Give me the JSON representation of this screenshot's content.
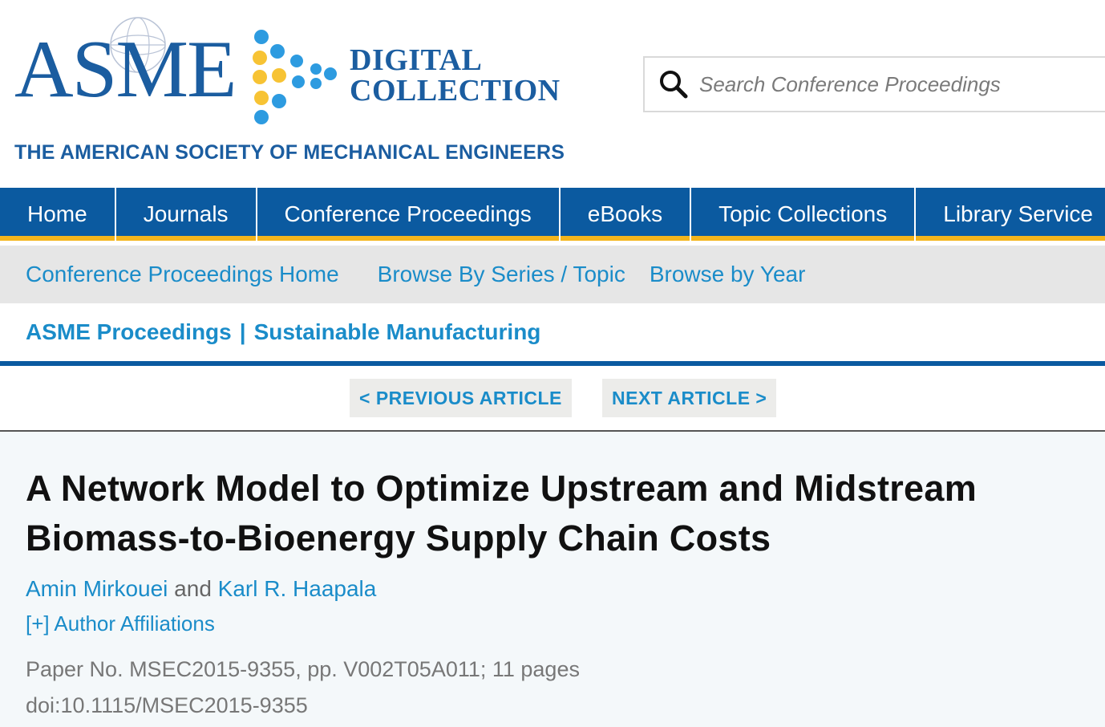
{
  "brand": {
    "logo_word": "ASME",
    "line1": "DIGITAL",
    "line2": "COLLECTION",
    "society": "THE AMERICAN SOCIETY OF MECHANICAL ENGINEERS",
    "primary_color": "#1b5da0",
    "dot_blue": "#2d9be0",
    "dot_yellow": "#f7c334"
  },
  "search": {
    "placeholder": "Search Conference Proceedings",
    "icon": "search-icon"
  },
  "main_nav": {
    "items": [
      "Home",
      "Journals",
      "Conference Proceedings",
      "eBooks",
      "Topic Collections",
      "Library Service"
    ],
    "bg_color": "#0b5aa0",
    "accent_color": "#f4b51c"
  },
  "sub_nav": {
    "items": [
      "Conference Proceedings Home",
      "Browse By Series / Topic",
      "Browse by Year"
    ]
  },
  "proceedings": {
    "left": "ASME Proceedings",
    "separator": "|",
    "right": "Sustainable Manufacturing"
  },
  "article_nav": {
    "prev": "< PREVIOUS ARTICLE",
    "next": "NEXT ARTICLE >"
  },
  "article": {
    "title_line1": "A Network Model to Optimize Upstream and Midstream",
    "title_line2": "Biomass-to-Bioenergy Supply Chain Costs",
    "authors": [
      "Amin Mirkouei",
      "Karl R. Haapala"
    ],
    "author_joiner": "and",
    "affiliations_toggle": "[+] Author Affiliations",
    "paper_no": "Paper No. MSEC2015-9355, pp. V002T05A011; 11 pages",
    "doi": "doi:10.1115/MSEC2015-9355"
  }
}
